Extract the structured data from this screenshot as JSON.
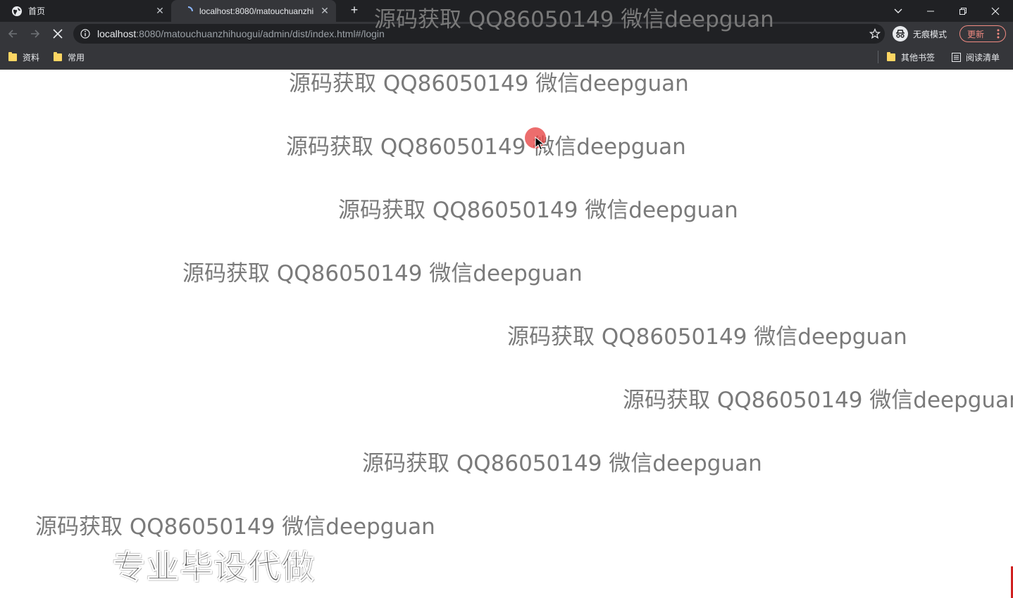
{
  "tabs": [
    {
      "title": "首页",
      "icon": "globe-icon"
    },
    {
      "title": "localhost:8080/matouchuanzhi",
      "icon": "loading-icon"
    }
  ],
  "toolbar": {
    "url_host": "localhost",
    "url_rest": ":8080/matouchuanzhihuogui/admin/dist/index.html#/login",
    "incognito_label": "无痕模式",
    "update_label": "更新"
  },
  "bookmarks": {
    "left": [
      "资料",
      "常用"
    ],
    "other": "其他书签",
    "reading_list": "阅读清单"
  },
  "page": {
    "watermark_text": "源码获取 QQ86050149 微信deepguan",
    "promo_text": "专业毕设代做"
  },
  "colors": {
    "tab_strip": "#202124",
    "toolbar": "#35363a",
    "watermark": "#7a7a7a",
    "update_accent": "#f28b82",
    "folder": "#fdd663"
  }
}
